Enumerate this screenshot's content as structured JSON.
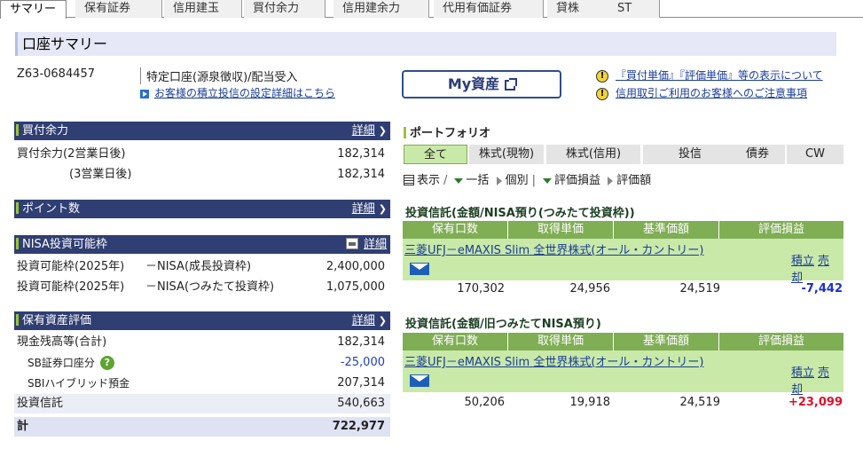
{
  "tabs": [
    "サマリー",
    "保有証券",
    "信用建玉",
    "買付余力",
    "信用建余力",
    "代用有価証券",
    "貸株",
    "ST"
  ],
  "page_title": "口座サマリー",
  "account": {
    "number": "Z63-0684457",
    "type": "特定口座(源泉徴収)/配当受入",
    "link": "お客様の積立投信の設定詳細はこちら"
  },
  "myasset_label": "My資産",
  "notices": [
    "『買付単価』『評価単価』等の表示について",
    "信用取引ご利用のお客様へのご注意事項"
  ],
  "buying_power": {
    "title": "買付余力",
    "detail": "詳細",
    "rows": [
      {
        "label": "買付余力(2営業日後)",
        "value": "182,314"
      },
      {
        "label": "(3営業日後)",
        "value": "182,314"
      }
    ]
  },
  "points": {
    "title": "ポイント数",
    "detail": "詳細"
  },
  "nisa": {
    "title": "NISA投資可能枠",
    "detail": "詳細",
    "rows": [
      {
        "label": "投資可能枠(2025年)",
        "sub": "－NISA(成長投資枠)",
        "value": "2,400,000"
      },
      {
        "label": "投資可能枠(2025年)",
        "sub": "－NISA(つみたて投資枠)",
        "value": "1,075,000"
      }
    ]
  },
  "assets": {
    "title": "保有資産評価",
    "detail": "詳細",
    "rows": [
      {
        "label": "現金残高等(合計)",
        "value": "182,314"
      },
      {
        "label": "SB証券口座分",
        "value": "-25,000"
      },
      {
        "label": "SBIハイブリッド預金",
        "value": "207,314"
      },
      {
        "label": "投資信託",
        "value": "540,663"
      },
      {
        "label": "計",
        "value": "722,977"
      }
    ]
  },
  "portfolio": {
    "title": "ポートフォリオ",
    "tabs": [
      "全て",
      "株式(現物)",
      "株式(信用)",
      "投信",
      "債券",
      "CW"
    ],
    "controls": {
      "display": "表示",
      "bulk": "一括",
      "individual": "個別",
      "pl": "評価損益",
      "amount": "評価額"
    }
  },
  "table_headers": [
    "保有口数",
    "取得単価",
    "基準価額",
    "評価損益"
  ],
  "fund_sections": [
    {
      "title": "投資信託(金額/NISA預り(つみたて投資枠))",
      "fund_name": "三菱UFJ－eMAXIS Slim 全世界株式(オール・カントリー)",
      "links": [
        "積立",
        "売却"
      ],
      "units": "170,302",
      "acq_price": "24,956",
      "nav": "24,519",
      "pl": "-7,442"
    },
    {
      "title": "投資信託(金額/旧つみたてNISA預り)",
      "fund_name": "三菱UFJ－eMAXIS Slim 全世界株式(オール・カントリー)",
      "links": [
        "積立",
        "売却"
      ],
      "units": "50,206",
      "acq_price": "19,918",
      "nav": "24,519",
      "pl": "+23,099"
    }
  ]
}
